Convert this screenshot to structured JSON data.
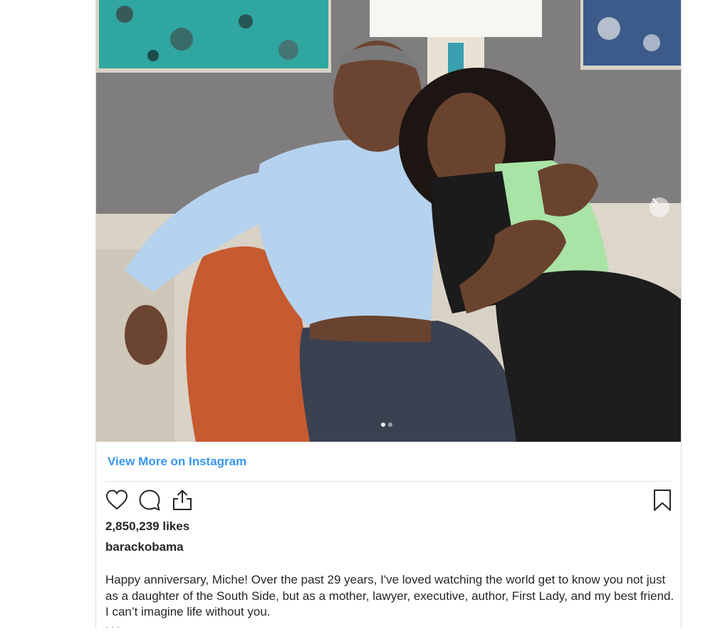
{
  "post": {
    "photo_alt": "",
    "carousel": {
      "count": 2,
      "active": 1
    }
  },
  "footer": {
    "view_more_label": "View More on Instagram",
    "likes_text": "2,850,239 likes",
    "username": "barackobama",
    "caption": "Happy anniversary, Miche! Over the past 29 years, I've loved watching the world get to know you not just as a daughter of the South Side, but as a mother, lawyer, executive, author, First Lady, and my best friend. I can’t imagine life without you.",
    "more_text": "· · ·"
  },
  "icons": {
    "like": "heart-icon",
    "comment": "comment-icon",
    "share": "share-icon",
    "save": "bookmark-icon",
    "next": "chevron-right-icon"
  },
  "colors": {
    "link": "#3897f0",
    "text": "#262626",
    "border": "#dbdbdb"
  }
}
